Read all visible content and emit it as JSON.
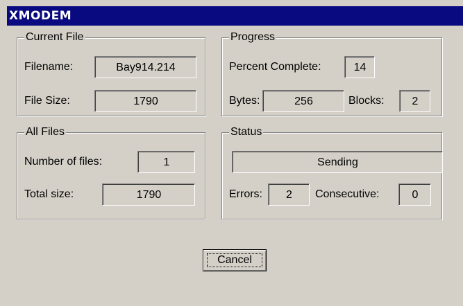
{
  "window": {
    "title": "XMODEM"
  },
  "current_file": {
    "legend": "Current File",
    "filename_label": "Filename:",
    "filename_value": "Bay914.214",
    "file_size_label": "File Size:",
    "file_size_value": "1790"
  },
  "progress": {
    "legend": "Progress",
    "percent_label": "Percent Complete:",
    "percent_value": "14",
    "bytes_label": "Bytes:",
    "bytes_value": "256",
    "blocks_label": "Blocks:",
    "blocks_value": "2"
  },
  "all_files": {
    "legend": "All Files",
    "number_label": "Number of files:",
    "number_value": "1",
    "total_label": "Total size:",
    "total_value": "1790"
  },
  "status": {
    "legend": "Status",
    "state_value": "Sending",
    "errors_label": "Errors:",
    "errors_value": "2",
    "consecutive_label": "Consecutive:",
    "consecutive_value": "0"
  },
  "buttons": {
    "cancel_label": "Cancel"
  },
  "colors": {
    "titlebar": "#0a0a80",
    "face": "#d4d0c8"
  }
}
